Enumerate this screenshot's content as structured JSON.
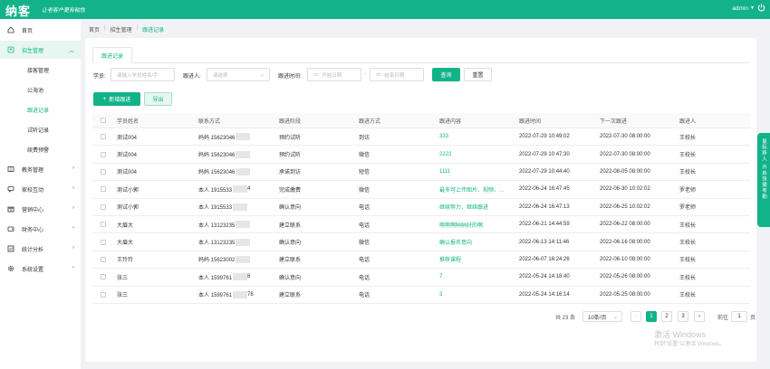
{
  "header": {
    "logo": "纳客",
    "slogan": "让老客户更有粘性",
    "user": "admin"
  },
  "sidebar": {
    "items": [
      {
        "label": "首页",
        "icon": "home-icon"
      },
      {
        "label": "招生管理",
        "icon": "enroll-icon"
      },
      {
        "label": "教务管理",
        "icon": "book-icon"
      },
      {
        "label": "家校互动",
        "icon": "chat-icon"
      },
      {
        "label": "营销中心",
        "icon": "gift-icon"
      },
      {
        "label": "财务中心",
        "icon": "wallet-icon"
      },
      {
        "label": "统计分析",
        "icon": "chart-icon"
      },
      {
        "label": "系统设置",
        "icon": "gear-icon"
      }
    ],
    "sub": [
      "接客管理",
      "公海池",
      "跟进记录",
      "试听记录",
      "续费预警"
    ]
  },
  "breadcrumb": [
    "首页",
    "招生管理",
    "跟进记录"
  ],
  "tab": "跟进记录",
  "filters": {
    "student_label": "学员:",
    "student_placeholder": "请输入学员姓名/手",
    "follower_label": "跟进人:",
    "follower_placeholder": "请选择",
    "time_label": "跟进时间:",
    "start_placeholder": "开始日期",
    "date_sep": "-",
    "end_placeholder": "结束日期",
    "search": "查询",
    "reset": "重置"
  },
  "actions": {
    "add": "新增跟进",
    "export": "导出"
  },
  "table": {
    "columns": [
      "学员姓名",
      "联系方式",
      "跟进阶段",
      "跟进方式",
      "跟进内容",
      "跟进时间",
      "下一次跟进",
      "跟进人"
    ],
    "rows": [
      {
        "name": "测试004",
        "contact": "妈妈 15623046",
        "stage": "预约试听",
        "method": "到访",
        "content": "333",
        "time": "2022-07-29 10:49:02",
        "next": "2022-07-30 08:00:00",
        "person": "王校长"
      },
      {
        "name": "测试004",
        "contact": "妈妈 15623046",
        "stage": "预约试听",
        "method": "微信",
        "content": "2222",
        "time": "2022-07-29 10:47:30",
        "next": "2022-07-30 08:00:00",
        "person": "王校长"
      },
      {
        "name": "测试004",
        "contact": "妈妈 15623046",
        "stage": "承诺到访",
        "method": "短信",
        "content": "1111",
        "time": "2022-07-29 10:44:40",
        "next": "2022-08-05 08:00:00",
        "person": "王校长"
      },
      {
        "name": "测试小郭",
        "contact": "本人 1915533",
        "stage": "完成缴费",
        "method": "微信",
        "content": "最多可上传图片、视频、...",
        "time": "2022-06-24 16:47:45",
        "next": "2022-06-30 10:02:02",
        "person": "罗老师"
      },
      {
        "name": "测试小郭",
        "contact": "本人 1915533",
        "stage": "确认意向",
        "method": "电话",
        "content": "继续努力、继续跟进",
        "time": "2022-06-24 16:47:13",
        "next": "2022-06-25 10:02:02",
        "person": "罗老师"
      },
      {
        "name": "大眉大",
        "contact": "本人 13123235",
        "stage": "建立联系",
        "method": "电话",
        "content": "啊啊啊呐呐好的啊",
        "time": "2022-06-21 14:44:59",
        "next": "2022-06-22 08:00:00",
        "person": "王校长"
      },
      {
        "name": "大眉大",
        "contact": "本人 13123235",
        "stage": "确认意向",
        "method": "微信",
        "content": "确认报名意向",
        "time": "2022-06-13 14:11:46",
        "next": "2022-06-16 08:00:00",
        "person": "王校长"
      },
      {
        "name": "王玲玲",
        "contact": "妈妈 15623002",
        "stage": "建立联系",
        "method": "电话",
        "content": "推荐课程",
        "time": "2022-06-07 16:24:26",
        "next": "2022-06-10 08:00:00",
        "person": "王校长"
      },
      {
        "name": "张三",
        "contact": "本人 1599761",
        "stage": "确认意向",
        "method": "电话",
        "content": "7",
        "time": "2022-05-24 14:18:40",
        "next": "2022-05-26 08:00:00",
        "person": "王校长"
      },
      {
        "name": "张三",
        "contact": "本人 1599761",
        "stage": "建立联系",
        "method": "电话",
        "content": "3",
        "time": "2022-05-24 14:16:14",
        "next": "2022-05-25 08:00:00",
        "person": "王校长"
      }
    ]
  },
  "contact_tails": [
    "",
    "",
    "",
    "4",
    "",
    "",
    "",
    "",
    "8",
    "78"
  ],
  "pagination": {
    "total": "共 23 条",
    "page_size": "10条/页",
    "pages": [
      "1",
      "2",
      "3"
    ],
    "goto_label": "前往",
    "goto_value": "1",
    "page_unit": "页"
  },
  "float_tab": "鼠标移入 开启快捷考勤",
  "watermark": {
    "line1": "激活 Windows",
    "line2": "转到\"设置\"以激活 Windows。"
  }
}
